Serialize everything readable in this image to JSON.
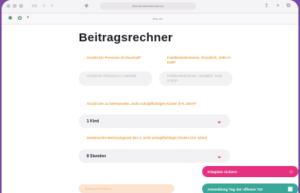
{
  "browser": {
    "url": "fliss-kindertraeume.de",
    "tab_title": "fliss.de"
  },
  "page": {
    "title": "Beitragsrechner"
  },
  "form": {
    "persons_label": "Anzahl der Personen im Haushalt*",
    "persons_placeholder": "Anzahl der Personen im Haushalt",
    "income_label": "Familieneinkommen, monatlich, netto in EUR*",
    "income_placeholder": "Familieneinkommen, monatlich, netto in EUR",
    "children_label": "Anzahl der zu betreuenden, nicht schulpflichtigen Kinder (0-6 Jahre)*",
    "children_value": "1 Kind",
    "hours_label": "Gewünschte Betreuungszeit des 1. nicht schulpflichtigen Kindes (0-6 Jahre)",
    "hours_value": "8 Stunden",
    "submit_label": "Beitrag berechnen"
  },
  "actions": {
    "kita_label": "Kitaplatz sichern",
    "open_day_label": "Anmeldung Tag der offenen Tür"
  },
  "colors": {
    "accent_orange": "#f29d3b",
    "pink": "#e7317f",
    "teal": "#3aa79a",
    "chevron_red": "#e0243e"
  }
}
